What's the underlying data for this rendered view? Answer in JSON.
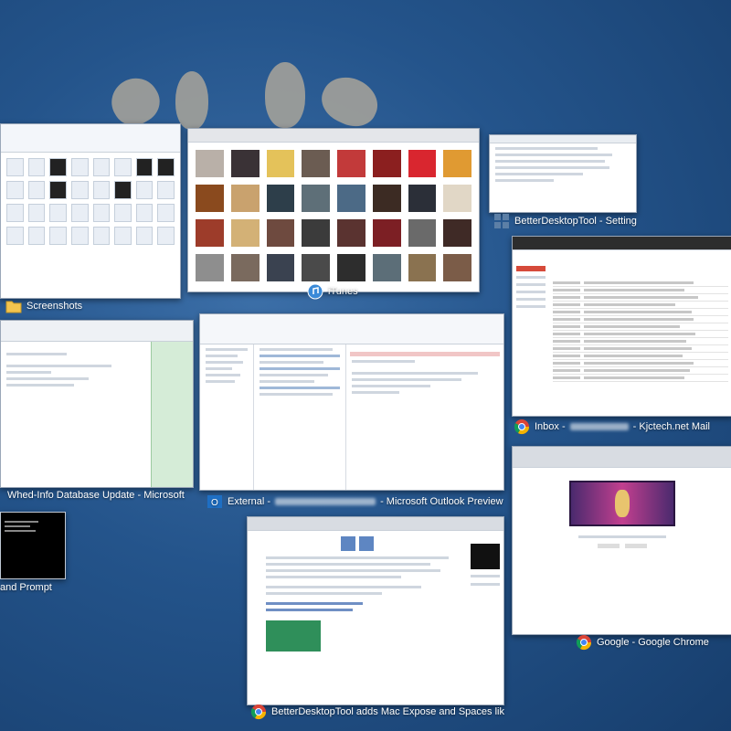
{
  "windows": [
    {
      "id": "explorer",
      "caption": "Screenshots",
      "icon": "folder-icon"
    },
    {
      "id": "itunes",
      "caption": "iTunes",
      "icon": "itunes-icon"
    },
    {
      "id": "bdt-settings",
      "caption": "BetterDesktopTool - Setting",
      "icon": "app-icon"
    },
    {
      "id": "gmail",
      "caption": "Inbox - ",
      "caption_blurred": "",
      "caption_tail": " - Kjctech.net Mail",
      "icon": "chrome-icon"
    },
    {
      "id": "word",
      "caption": "Whed-Info Database Update - Microsoft",
      "icon": "word-icon"
    },
    {
      "id": "outlook",
      "caption": "External - ",
      "caption_tail": " - Microsoft Outlook Preview",
      "icon": "outlook-icon"
    },
    {
      "id": "cmd",
      "caption": "and Prompt",
      "icon": "cmd-icon"
    },
    {
      "id": "blog",
      "caption": "BetterDesktopTool adds Mac Expose and Spaces lik",
      "icon": "chrome-icon"
    },
    {
      "id": "google",
      "caption": "Google - Google Chrome",
      "icon": "chrome-icon"
    }
  ],
  "colors": {
    "chrome_red": "#db4437",
    "chrome_green": "#0f9d58",
    "chrome_yellow": "#f4b400",
    "chrome_blue": "#4285f4",
    "folder": "#f2c44f",
    "outlook": "#1e6fc4",
    "itunes": "#3a8ad8"
  }
}
